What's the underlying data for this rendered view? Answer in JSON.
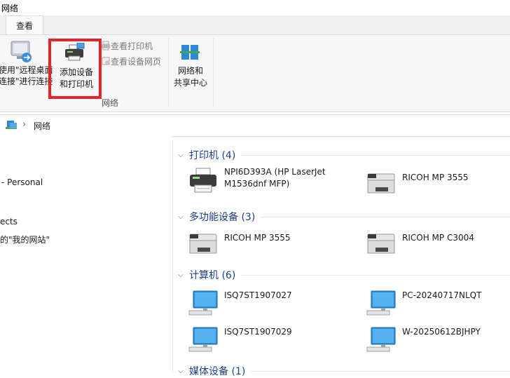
{
  "window": {
    "title": "网络"
  },
  "tabs": [
    {
      "label": "查看"
    }
  ],
  "ribbon": {
    "remote_desktop_label": "使用\"远程桌面\n连接\"进行连接",
    "add_devices_label": "添加设备\n和打印机",
    "view_printers_label": "查看打印机",
    "view_device_webpage_label": "查看设备网页",
    "network_sharing_label": "网络和\n共享中心",
    "group_label": "网络"
  },
  "address_bar": {
    "breadcrumb": "网络",
    "separator": "›"
  },
  "nav_pane": {
    "items": [
      {
        "label": "- Personal"
      },
      {
        "label": "ects"
      },
      {
        "label": "的\"我的网站\""
      }
    ]
  },
  "groups": [
    {
      "title": "打印机 (4)",
      "items": [
        {
          "name": "NPI6D393A (HP LaserJet\nM1536dnf MFP)",
          "icon": "printer-icon"
        },
        {
          "name": "RICOH MP 3555",
          "icon": "printer-icon"
        }
      ]
    },
    {
      "title": "多功能设备 (3)",
      "items": [
        {
          "name": "RICOH MP 3555",
          "icon": "printer-icon"
        },
        {
          "name": "RICOH MP C3004",
          "icon": "printer-icon"
        }
      ]
    },
    {
      "title": "计算机 (6)",
      "items": [
        {
          "name": "ISQ7ST1907027",
          "icon": "computer-icon"
        },
        {
          "name": "PC-20240717NLQT",
          "icon": "computer-icon"
        },
        {
          "name": "ISQ7ST1907029",
          "icon": "computer-icon"
        },
        {
          "name": "W-20250612BJHPY",
          "icon": "computer-icon"
        }
      ]
    },
    {
      "title": "媒体设备 (1)",
      "items": []
    }
  ],
  "colors": {
    "highlight": "#e8242a",
    "group_header": "#1c3f8c",
    "ribbon_bg": "#f7f7f7"
  }
}
